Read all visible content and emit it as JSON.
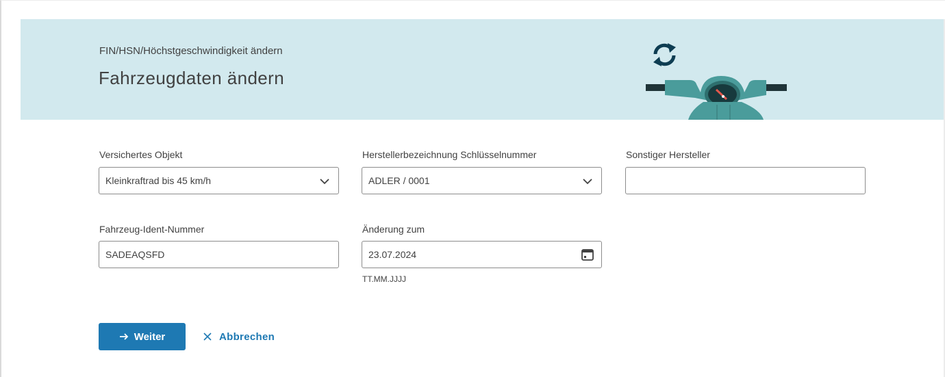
{
  "header": {
    "breadcrumb": "FIN/HSN/Höchstgeschwindigkeit ändern",
    "title": "Fahrzeugdaten ändern"
  },
  "form": {
    "insured_object": {
      "label": "Versichertes Objekt",
      "value": "Kleinkraftrad bis 45 km/h"
    },
    "manufacturer": {
      "label": "Herstellerbezeichnung Schlüsselnummer",
      "value": "ADLER / 0001"
    },
    "other_manufacturer": {
      "label": "Sonstiger Hersteller",
      "value": ""
    },
    "vin": {
      "label": "Fahrzeug-Ident-Nummer",
      "value": "SADEAQSFD"
    },
    "change_date": {
      "label": "Änderung zum",
      "value": "23.07.2024",
      "hint": "TT.MM.JJJJ"
    }
  },
  "actions": {
    "next_label": "Weiter",
    "cancel_label": "Abbrechen"
  },
  "icons": {
    "next": "arrow-right-icon",
    "cancel": "close-icon",
    "select": "chevron-down-icon",
    "date": "calendar-icon",
    "banner": "refresh-icon"
  },
  "colors": {
    "banner_bg": "#d2e9ee",
    "accent": "#1e79b3",
    "scooter": "#4a9c9b",
    "text": "#414141"
  }
}
